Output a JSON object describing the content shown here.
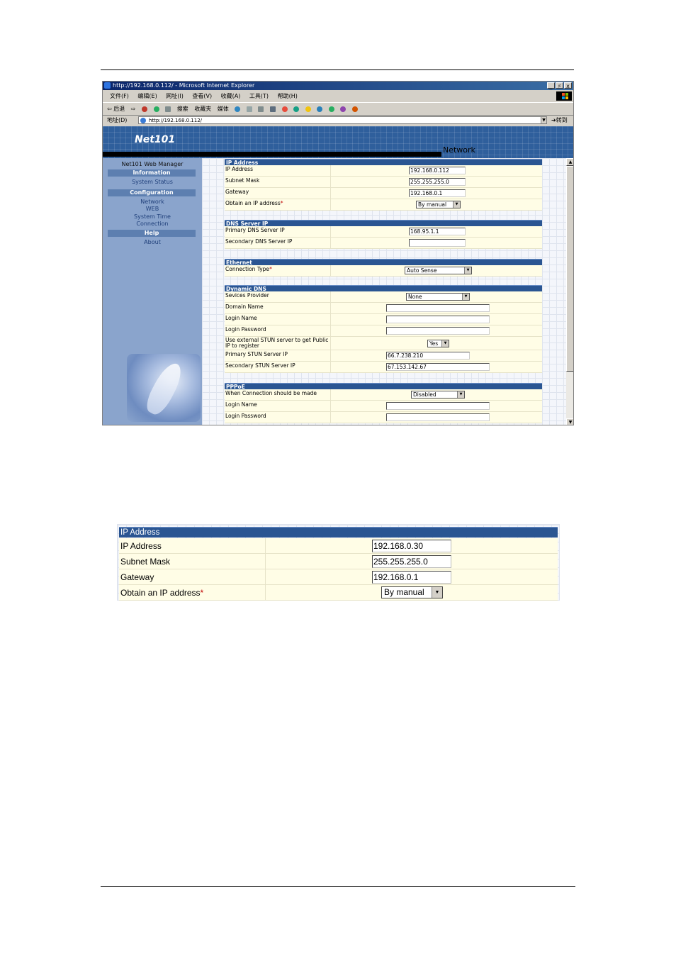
{
  "window": {
    "title": "http://192.168.0.112/ - Microsoft Internet Explorer",
    "buttons": [
      "_",
      "♯",
      "x"
    ]
  },
  "menubar": [
    "文件(F)",
    "编辑(E)",
    "网址(I)",
    "查看(V)",
    "收藏(A)",
    "工具(T)",
    "帮助(H)"
  ],
  "toolbar": {
    "back": "⇦ 后退",
    "search": "搜索",
    "favorites": "收藏夹",
    "media": "媒体"
  },
  "addressbar": {
    "label": "地址(D)",
    "url": "http://192.168.0.112/",
    "go": "转到"
  },
  "banner": {
    "logo": "Net101",
    "page_name": "Network"
  },
  "sidebar": {
    "title": "Net101 Web Manager",
    "information": "Information",
    "system_status": "System Status",
    "configuration": "Configuration",
    "network": "Network",
    "web": "WEB",
    "system_time": "System Time",
    "connection": "Connection",
    "help": "Help",
    "about": "About"
  },
  "ip_section": {
    "header": "IP Address",
    "ip_label": "IP Address",
    "ip_value": "192.168.0.112",
    "mask_label": "Subnet Mask",
    "mask_value": "255.255.255.0",
    "gateway_label": "Gateway",
    "gateway_value": "192.168.0.1",
    "obtain_label": "Obtain an IP address",
    "obtain_value": "By manual"
  },
  "dns_section": {
    "header": "DNS Server IP",
    "primary_label": "Primary DNS Server IP",
    "primary_value": "168.95.1.1",
    "secondary_label": "Secondary DNS Server IP",
    "secondary_value": ""
  },
  "ethernet_section": {
    "header": "Ethernet",
    "conn_label": "Connection Type",
    "conn_value": "Auto Sense"
  },
  "ddns_section": {
    "header": "Dynamic DNS",
    "provider_label": "Sevices Provider",
    "provider_value": "None",
    "domain_label": "Domain Name",
    "domain_value": "",
    "login_label": "Login Name",
    "login_value": "",
    "password_label": "Login Password",
    "password_value": "",
    "stun_label": "Use external STUN server to get Public IP to register",
    "stun_value": "Yes",
    "stun_primary_label": "Primary STUN Server IP",
    "stun_primary_value": "66.7.238.210",
    "stun_secondary_label": "Secondary STUN Server IP",
    "stun_secondary_value": "67.153.142.67"
  },
  "pppoe_section": {
    "header": "PPPoE",
    "when_label": "When Connection should be made",
    "when_value": "Disabled",
    "login_label": "Login Name",
    "login_value": "",
    "password_label": "Login Password",
    "password_value": ""
  },
  "required_mark": "*",
  "zoom": {
    "header": "IP Address",
    "ip_label": "IP Address",
    "ip_value": "192.168.0.30",
    "mask_label": "Subnet Mask",
    "mask_value": "255.255.255.0",
    "gateway_label": "Gateway",
    "gateway_value": "192.168.0.1",
    "obtain_label": "Obtain an IP address",
    "obtain_value": "By manual"
  },
  "colors": {
    "section_header": "#2a5592",
    "row_background": "#fffde6",
    "sidebar": "#8aa4cc",
    "required": "#c00000"
  }
}
